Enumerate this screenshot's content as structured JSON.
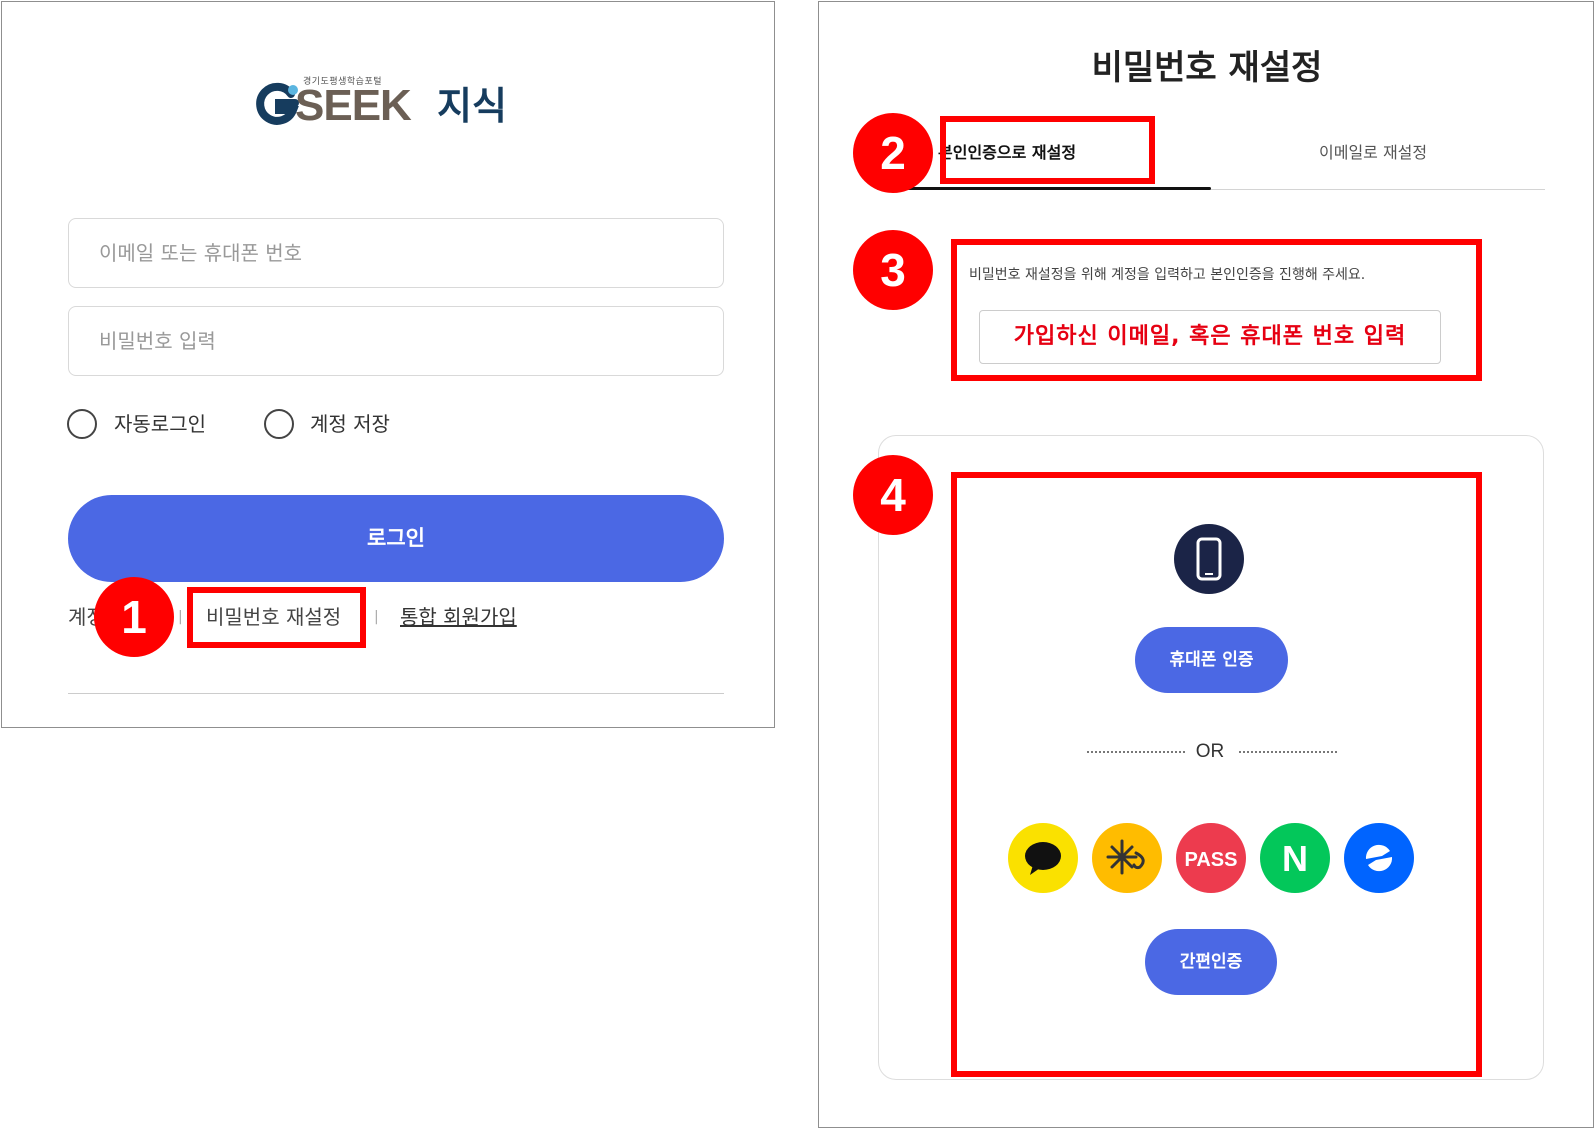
{
  "login": {
    "logo": {
      "subtitle": "경기도평생학습포털",
      "brand": "SEEK",
      "brand_suffix": "지식"
    },
    "email_placeholder": "이메일 또는 휴대폰 번호",
    "password_placeholder": "비밀번호 입력",
    "auto_login_label": "자동로그인",
    "save_account_label": "계정 저장",
    "login_button": "로그인",
    "links": {
      "find_account": "계정",
      "reset_password": "비밀번호 재설정",
      "signup": "통합 회원가입",
      "separator": "|"
    }
  },
  "reset": {
    "title": "비밀번호 재설정",
    "tabs": [
      "본인인증으로 재설정",
      "이메일로 재설정"
    ],
    "guide": "비밀번호 재설정을 위해 계정을 입력하고 본인인증을 진행해 주세요.",
    "account_input": "가입하신 이메일, 혹은 휴대폰 번호 입력",
    "phone_auth_button": "휴대폰 인증",
    "or_label": "OR",
    "cert_providers": [
      {
        "name": "kakao",
        "icon": "kakao-talk-icon",
        "color": "#fae100"
      },
      {
        "name": "kb",
        "icon": "kb-star-icon",
        "color": "#ffbc00"
      },
      {
        "name": "pass",
        "label": "PASS",
        "icon": "pass-icon",
        "color": "#ed3b4e"
      },
      {
        "name": "naver",
        "label": "N",
        "icon": "naver-icon",
        "color": "#03c75a"
      },
      {
        "name": "toss",
        "icon": "toss-icon",
        "color": "#0064ff"
      }
    ],
    "simple_auth_button": "간편인증"
  },
  "annotations": [
    "1",
    "2",
    "3",
    "4"
  ],
  "colors": {
    "primary": "#4b68e4",
    "annotation": "#ff0000",
    "dark_navy": "#1b2447"
  }
}
